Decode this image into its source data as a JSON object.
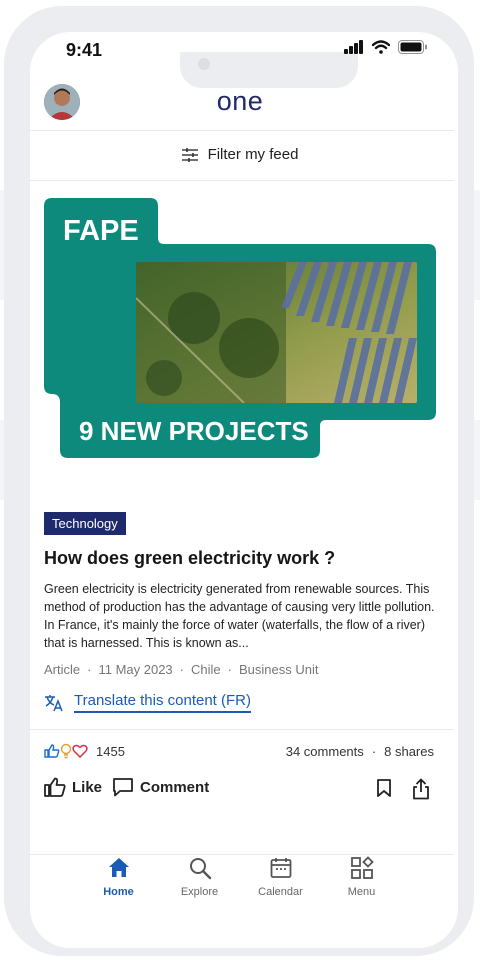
{
  "status_bar": {
    "time": "9:41"
  },
  "header": {
    "brand": "one"
  },
  "filter": {
    "label": "Filter my feed"
  },
  "post": {
    "banner": {
      "headline": "FAPE",
      "subheadline": "9 NEW PROJECTS"
    },
    "category": "Technology",
    "title": "How does green electricity work ?",
    "body": "Green electricity is electricity generated from renewable sources. This method of production has the advantage of causing very little pollution. In France, it's mainly the force of water (waterfalls, the flow of a river) that is harnessed. This is known as...",
    "meta": {
      "type": "Article",
      "date": "11 May 2023",
      "country": "Chile",
      "unit": "Business Unit"
    },
    "translate_label": "Translate this content (FR)",
    "reaction_count": "1455",
    "comments": "34 comments",
    "shares": "8 shares",
    "actions": {
      "like": "Like",
      "comment": "Comment"
    }
  },
  "nav": [
    {
      "label": "Home",
      "icon": "home-icon",
      "active": true
    },
    {
      "label": "Explore",
      "icon": "search-icon",
      "active": false
    },
    {
      "label": "Calendar",
      "icon": "calendar-icon",
      "active": false
    },
    {
      "label": "Menu",
      "icon": "grid-icon",
      "active": false
    }
  ],
  "colors": {
    "teal": "#0e8a7d",
    "navy": "#1e2a6b",
    "link": "#1a5bb5"
  }
}
